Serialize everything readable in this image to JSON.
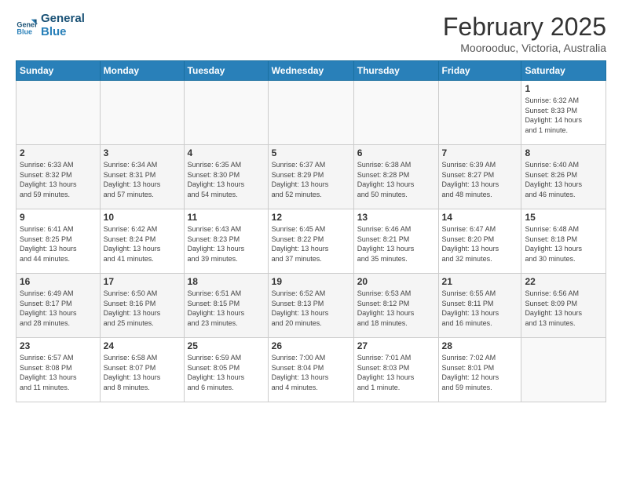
{
  "header": {
    "logo_line1": "General",
    "logo_line2": "Blue",
    "title": "February 2025",
    "location": "Moorooduc, Victoria, Australia"
  },
  "days_of_week": [
    "Sunday",
    "Monday",
    "Tuesday",
    "Wednesday",
    "Thursday",
    "Friday",
    "Saturday"
  ],
  "weeks": [
    [
      {
        "day": "",
        "info": ""
      },
      {
        "day": "",
        "info": ""
      },
      {
        "day": "",
        "info": ""
      },
      {
        "day": "",
        "info": ""
      },
      {
        "day": "",
        "info": ""
      },
      {
        "day": "",
        "info": ""
      },
      {
        "day": "1",
        "info": "Sunrise: 6:32 AM\nSunset: 8:33 PM\nDaylight: 14 hours\nand 1 minute."
      }
    ],
    [
      {
        "day": "2",
        "info": "Sunrise: 6:33 AM\nSunset: 8:32 PM\nDaylight: 13 hours\nand 59 minutes."
      },
      {
        "day": "3",
        "info": "Sunrise: 6:34 AM\nSunset: 8:31 PM\nDaylight: 13 hours\nand 57 minutes."
      },
      {
        "day": "4",
        "info": "Sunrise: 6:35 AM\nSunset: 8:30 PM\nDaylight: 13 hours\nand 54 minutes."
      },
      {
        "day": "5",
        "info": "Sunrise: 6:37 AM\nSunset: 8:29 PM\nDaylight: 13 hours\nand 52 minutes."
      },
      {
        "day": "6",
        "info": "Sunrise: 6:38 AM\nSunset: 8:28 PM\nDaylight: 13 hours\nand 50 minutes."
      },
      {
        "day": "7",
        "info": "Sunrise: 6:39 AM\nSunset: 8:27 PM\nDaylight: 13 hours\nand 48 minutes."
      },
      {
        "day": "8",
        "info": "Sunrise: 6:40 AM\nSunset: 8:26 PM\nDaylight: 13 hours\nand 46 minutes."
      }
    ],
    [
      {
        "day": "9",
        "info": "Sunrise: 6:41 AM\nSunset: 8:25 PM\nDaylight: 13 hours\nand 44 minutes."
      },
      {
        "day": "10",
        "info": "Sunrise: 6:42 AM\nSunset: 8:24 PM\nDaylight: 13 hours\nand 41 minutes."
      },
      {
        "day": "11",
        "info": "Sunrise: 6:43 AM\nSunset: 8:23 PM\nDaylight: 13 hours\nand 39 minutes."
      },
      {
        "day": "12",
        "info": "Sunrise: 6:45 AM\nSunset: 8:22 PM\nDaylight: 13 hours\nand 37 minutes."
      },
      {
        "day": "13",
        "info": "Sunrise: 6:46 AM\nSunset: 8:21 PM\nDaylight: 13 hours\nand 35 minutes."
      },
      {
        "day": "14",
        "info": "Sunrise: 6:47 AM\nSunset: 8:20 PM\nDaylight: 13 hours\nand 32 minutes."
      },
      {
        "day": "15",
        "info": "Sunrise: 6:48 AM\nSunset: 8:18 PM\nDaylight: 13 hours\nand 30 minutes."
      }
    ],
    [
      {
        "day": "16",
        "info": "Sunrise: 6:49 AM\nSunset: 8:17 PM\nDaylight: 13 hours\nand 28 minutes."
      },
      {
        "day": "17",
        "info": "Sunrise: 6:50 AM\nSunset: 8:16 PM\nDaylight: 13 hours\nand 25 minutes."
      },
      {
        "day": "18",
        "info": "Sunrise: 6:51 AM\nSunset: 8:15 PM\nDaylight: 13 hours\nand 23 minutes."
      },
      {
        "day": "19",
        "info": "Sunrise: 6:52 AM\nSunset: 8:13 PM\nDaylight: 13 hours\nand 20 minutes."
      },
      {
        "day": "20",
        "info": "Sunrise: 6:53 AM\nSunset: 8:12 PM\nDaylight: 13 hours\nand 18 minutes."
      },
      {
        "day": "21",
        "info": "Sunrise: 6:55 AM\nSunset: 8:11 PM\nDaylight: 13 hours\nand 16 minutes."
      },
      {
        "day": "22",
        "info": "Sunrise: 6:56 AM\nSunset: 8:09 PM\nDaylight: 13 hours\nand 13 minutes."
      }
    ],
    [
      {
        "day": "23",
        "info": "Sunrise: 6:57 AM\nSunset: 8:08 PM\nDaylight: 13 hours\nand 11 minutes."
      },
      {
        "day": "24",
        "info": "Sunrise: 6:58 AM\nSunset: 8:07 PM\nDaylight: 13 hours\nand 8 minutes."
      },
      {
        "day": "25",
        "info": "Sunrise: 6:59 AM\nSunset: 8:05 PM\nDaylight: 13 hours\nand 6 minutes."
      },
      {
        "day": "26",
        "info": "Sunrise: 7:00 AM\nSunset: 8:04 PM\nDaylight: 13 hours\nand 4 minutes."
      },
      {
        "day": "27",
        "info": "Sunrise: 7:01 AM\nSunset: 8:03 PM\nDaylight: 13 hours\nand 1 minute."
      },
      {
        "day": "28",
        "info": "Sunrise: 7:02 AM\nSunset: 8:01 PM\nDaylight: 12 hours\nand 59 minutes."
      },
      {
        "day": "",
        "info": ""
      }
    ]
  ]
}
